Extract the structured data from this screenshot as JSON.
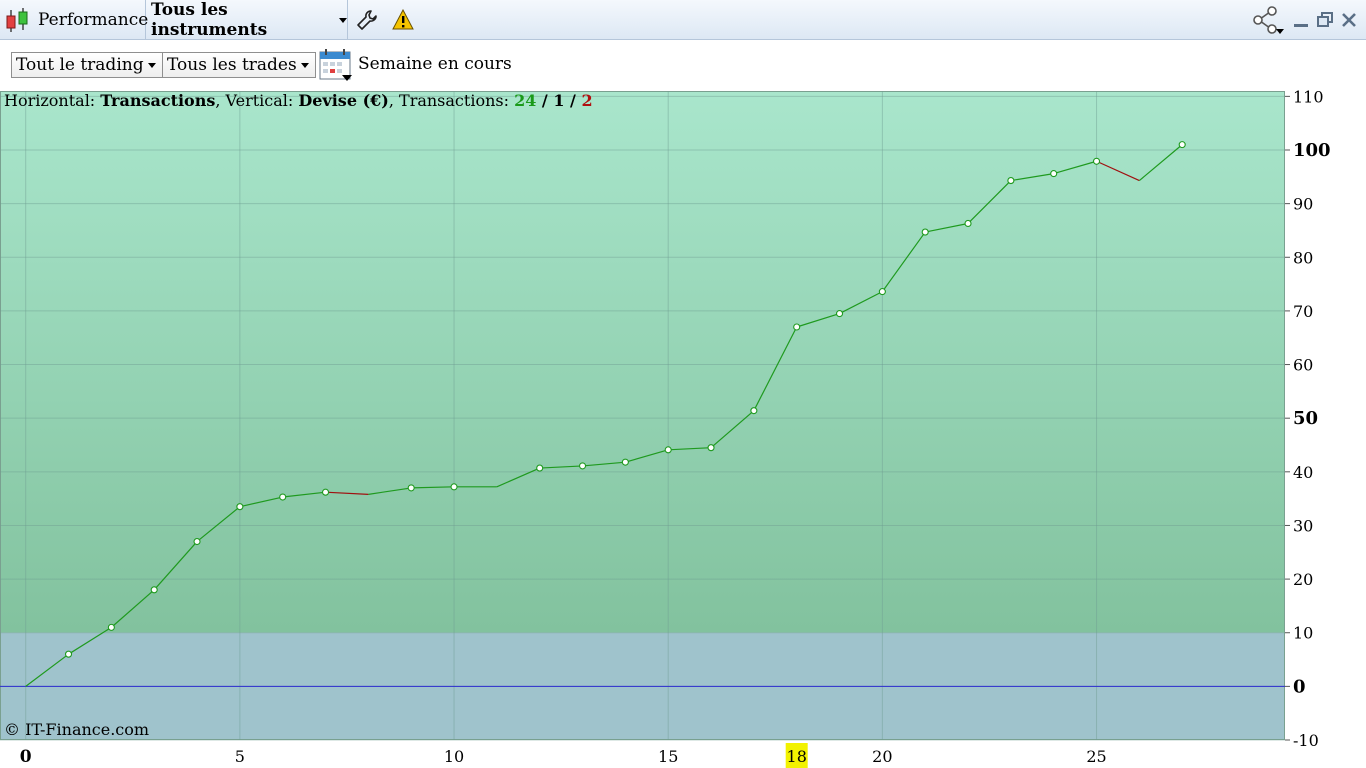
{
  "titlebar": {
    "performance_label": "Performance",
    "instruments_label": "Tous les instruments"
  },
  "toolbar": {
    "trading_filter": "Tout le trading",
    "trades_filter": "Tous les trades",
    "period_label": "Semaine en cours"
  },
  "info": {
    "horizontal_prefix": "Horizontal: ",
    "horizontal_value": "Transactions",
    "vertical_prefix": ", Vertical: ",
    "vertical_value": "Devise (€)",
    "transactions_prefix": ", Transactions: ",
    "wins": "24",
    "sep1": " / ",
    "neutral": "1",
    "sep2": " / ",
    "losses": "2"
  },
  "copyright": "© IT-Finance.com",
  "colors": {
    "win_line": "#1f9a1f",
    "loss_line": "#a01010",
    "zero_line": "#2b2bd0",
    "bg_top": "#a9e6cc",
    "bg_bottom": "#82c29e",
    "below_band": "#9fc3cc",
    "highlight": "#f2f200"
  },
  "chart_data": {
    "type": "line",
    "xlabel": "Transactions",
    "ylabel": "Devise (€)",
    "xlim": [
      -0.6,
      29.4
    ],
    "ylim": [
      -10,
      111
    ],
    "x_ticks": [
      "0",
      "5",
      "10",
      "15",
      "20",
      "25"
    ],
    "x_highlight": "18",
    "y_ticks": [
      "110",
      "100",
      "90",
      "80",
      "70",
      "60",
      "50",
      "40",
      "30",
      "20",
      "10",
      "0",
      "-10"
    ],
    "y_bold_ticks": [
      "100",
      "50",
      "0"
    ],
    "grid": true,
    "x": [
      0,
      1,
      2,
      3,
      4,
      5,
      6,
      7,
      8,
      9,
      10,
      11,
      12,
      13,
      14,
      15,
      16,
      17,
      18,
      19,
      20,
      21,
      22,
      23,
      24,
      25,
      26,
      27
    ],
    "values": [
      0,
      6,
      11,
      18,
      27,
      33.5,
      35.3,
      36.2,
      35.8,
      37,
      37.2,
      37.2,
      40.7,
      41.1,
      41.8,
      44.1,
      44.5,
      51.4,
      67,
      69.5,
      73.6,
      84.7,
      86.3,
      94.3,
      95.6,
      97.9,
      94.3,
      101
    ],
    "outcomes": [
      "start",
      "win",
      "win",
      "win",
      "win",
      "win",
      "win",
      "win",
      "loss",
      "win",
      "win",
      "neutral",
      "win",
      "win",
      "win",
      "win",
      "win",
      "win",
      "win",
      "win",
      "win",
      "win",
      "win",
      "win",
      "win",
      "win",
      "loss",
      "win"
    ]
  }
}
